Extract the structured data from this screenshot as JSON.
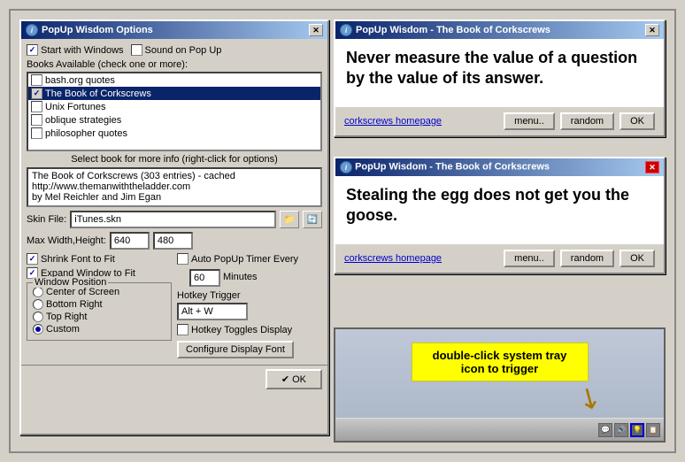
{
  "options_dialog": {
    "title": "PopUp Wisdom Options",
    "close_btn": "✕",
    "start_with_windows": "Start with Windows",
    "sound_on_popup": "Sound on Pop Up",
    "books_label": "Books Available (check one or more):",
    "books": [
      {
        "label": "bash.org quotes",
        "checked": false,
        "selected": false
      },
      {
        "label": "The Book of Corkscrews",
        "checked": true,
        "selected": true
      },
      {
        "label": "Unix Fortunes",
        "checked": false,
        "selected": false
      },
      {
        "label": "oblique strategies",
        "checked": false,
        "selected": false
      },
      {
        "label": "philosopher quotes",
        "checked": false,
        "selected": false
      }
    ],
    "select_book_hint": "Select book for more info (right-click for options)",
    "book_info": "The Book of Corkscrews (303 entries) - cached\nhttp://www.themanwiththeladder.com\nby Mel Reichler and Jim Egan",
    "skin_label": "Skin File:",
    "skin_value": "iTunes.skn",
    "max_label": "Max Width,Height:",
    "max_width": "640",
    "max_height": "480",
    "shrink_font": "Shrink Font to Fit",
    "expand_window": "Expand Window to Fit",
    "window_position_label": "Window Position",
    "positions": [
      {
        "label": "Center of Screen",
        "selected": false
      },
      {
        "label": "Bottom Right",
        "selected": false
      },
      {
        "label": "Top Right",
        "selected": false
      },
      {
        "label": "Custom",
        "selected": true
      }
    ],
    "auto_popup_label": "Auto PopUp Timer Every",
    "auto_popup_minutes": "60",
    "minutes_label": "Minutes",
    "hotkey_label": "Hotkey Trigger",
    "hotkey_value": "Alt + W",
    "hotkey_toggles": "Hotkey Toggles Display",
    "configure_display_font": "Configure Display Font",
    "ok_label": "✔ OK",
    "tray_icons": [
      "💬",
      "🔊",
      "🌐",
      "📋"
    ]
  },
  "popup1": {
    "title": "PopUp Wisdom - The Book of Corkscrews",
    "text": "Never measure the value of a question by the value of its answer.",
    "link": "corkscrews homepage",
    "menu_btn": "menu..",
    "random_btn": "random",
    "ok_btn": "OK"
  },
  "popup2": {
    "title": "PopUp Wisdom - The Book of Corkscrews",
    "text": "Stealing the egg does not get you the goose.",
    "link": "corkscrews homepage",
    "menu_btn": "menu..",
    "random_btn": "random",
    "ok_btn": "OK",
    "close_btn": "✕"
  },
  "tray_demo": {
    "instruction": "double-click system tray icon to trigger"
  }
}
